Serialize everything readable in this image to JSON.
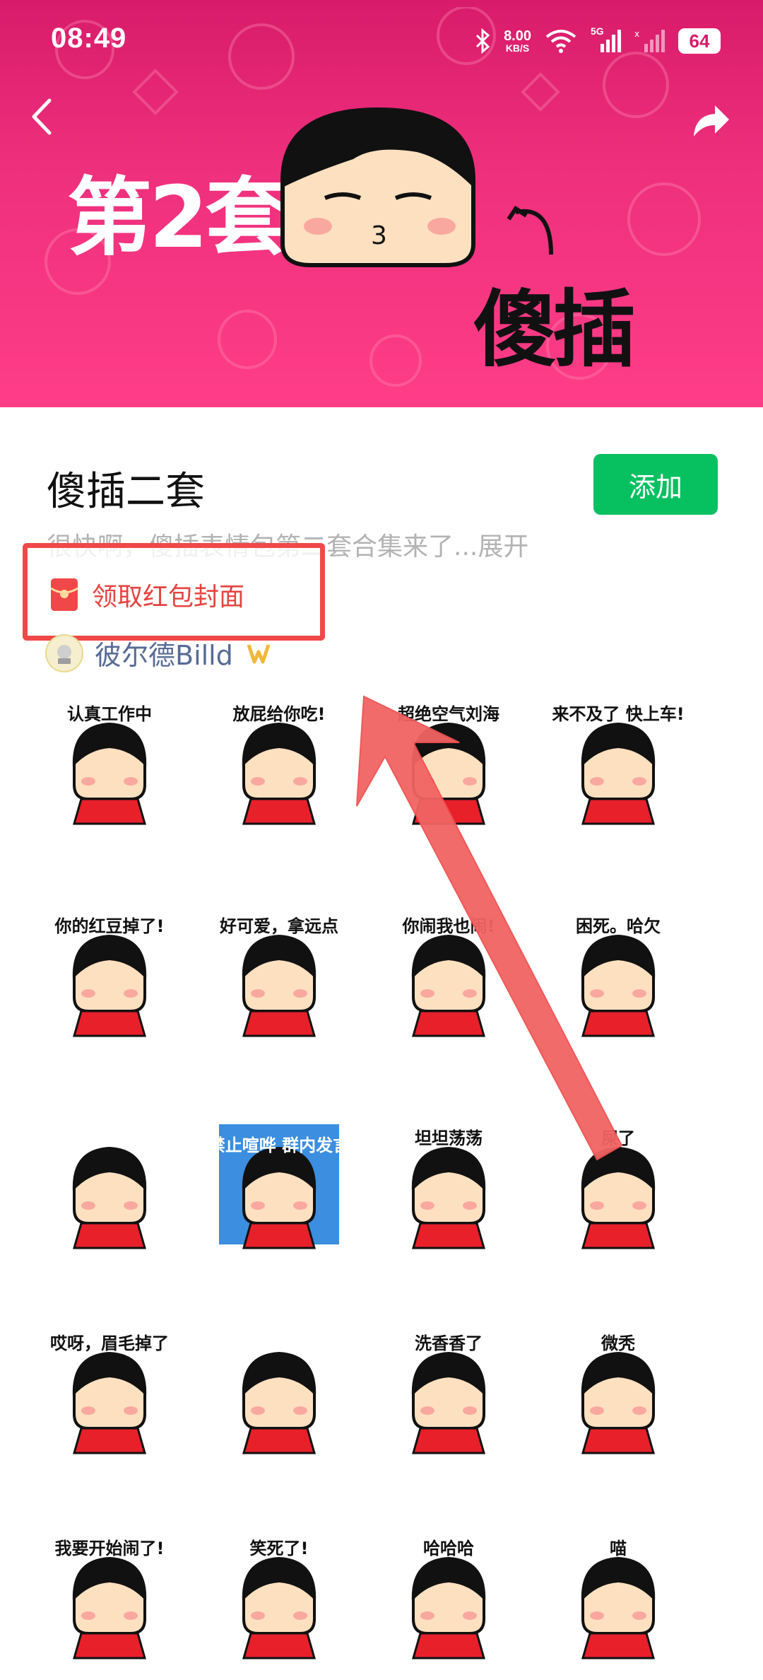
{
  "status_bar": {
    "time": "08:49",
    "net_speed_value": "8.00",
    "net_speed_unit": "KB/S",
    "network_5g": "5G",
    "battery": "64"
  },
  "banner": {
    "title_left": "第2套",
    "title_right": "傻插"
  },
  "pack": {
    "title": "傻插二套",
    "add_label": "添加",
    "description": "很快啊，傻插表情包第二套合集来了...展开",
    "red_packet_label": "领取红包封面",
    "author": "彼尔德Billd"
  },
  "stickers": [
    {
      "caption": "认真工作中"
    },
    {
      "caption": "放屁给你吃!"
    },
    {
      "caption": "超绝空气刘海"
    },
    {
      "caption": "来不及了 快上车!"
    },
    {
      "caption": "你的红豆掉了!"
    },
    {
      "caption": "好可爱，拿远点"
    },
    {
      "caption": "你闹我也闹!"
    },
    {
      "caption": "困死。哈欠"
    },
    {
      "caption": ""
    },
    {
      "caption": "禁止喧哗 群内发言"
    },
    {
      "caption": "坦坦荡荡"
    },
    {
      "caption": "屎了"
    },
    {
      "caption": "哎呀，眉毛掉了"
    },
    {
      "caption": ""
    },
    {
      "caption": "洗香香了"
    },
    {
      "caption": "微秃"
    },
    {
      "caption": "我要开始闹了!"
    },
    {
      "caption": "笑死了!"
    },
    {
      "caption": "哈哈哈"
    },
    {
      "caption": "喵"
    }
  ],
  "colors": {
    "banner": "#ee2f7c",
    "add_button": "#07c160",
    "highlight": "#f04848",
    "author": "#576b95"
  }
}
